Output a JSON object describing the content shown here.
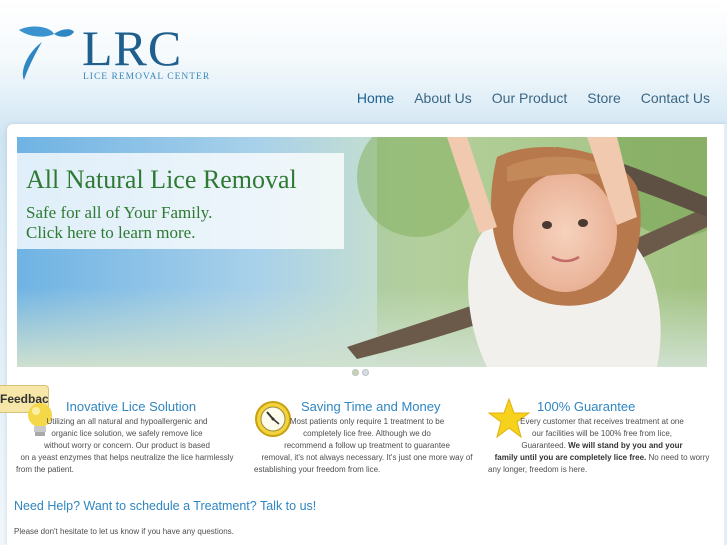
{
  "brand": {
    "name": "LRC",
    "tagline": "LICE REMOVAL CENTER",
    "logo_icon": "propeller-logo-icon",
    "accent_color": "#1f5f8e"
  },
  "nav": {
    "items": [
      {
        "label": "Home",
        "active": true
      },
      {
        "label": "About Us",
        "active": false
      },
      {
        "label": "Our Product",
        "active": false
      },
      {
        "label": "Store",
        "active": false
      },
      {
        "label": "Contact Us",
        "active": false
      }
    ]
  },
  "hero": {
    "title": "All Natural Lice Removal",
    "subtitle_line1": "Safe for all of Your Family.",
    "subtitle_line2": "Click here to learn more.",
    "slide_count": 2,
    "active_slide": 1
  },
  "feedback": {
    "label": "Feedback"
  },
  "features": [
    {
      "icon": "lightbulb-icon",
      "title": "Inovative Lice Solution",
      "lines": [
        "Utilizing an all natural and hypoallergenic and",
        "organic lice solution, we safely remove lice",
        "without worry or concern. Our product is based",
        "on a yeast enzymes that helps neutralize the lice harmlessly",
        "from the patient."
      ]
    },
    {
      "icon": "clock-icon",
      "title": "Saving Time and Money",
      "lines": [
        "Most patients only require 1 treatment to be",
        "completely lice free.  Although we do",
        "recommend a follow up treatment to guarantee",
        "removal, it's not always necessary. It's just one more way of",
        "establishing your freedom from lice."
      ]
    },
    {
      "icon": "star-icon",
      "title": "100% Guarantee",
      "line1": "Every customer that receives treatment at one",
      "line2": "our facilities will be 100% free from lice,",
      "line3_plain": "Guaranteed. ",
      "line3_bold": "We will stand by you and your",
      "line4_bold": "family until you are completely lice free.",
      "line4_plain": " No need to worry",
      "line5": "any longer, freedom is here."
    }
  ],
  "help": {
    "title": "Need Help? Want to schedule a Treatment? Talk to us!",
    "text": "Please don't hesitate to let us know if you have any questions."
  }
}
